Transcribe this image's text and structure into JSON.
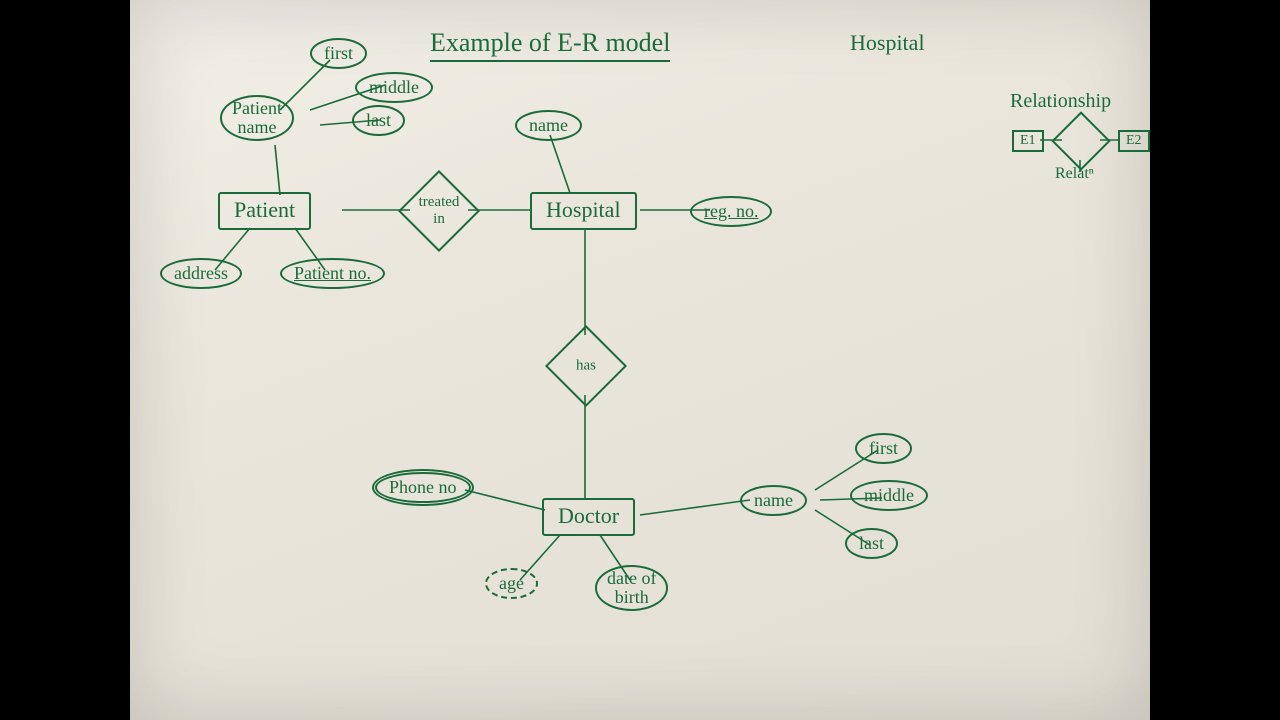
{
  "title": "Example of E-R model",
  "top_right_label": "Hospital",
  "entities": {
    "patient": "Patient",
    "hospital": "Hospital",
    "doctor": "Doctor"
  },
  "relationships": {
    "treated_in": "treated\nin",
    "has": "has"
  },
  "attributes": {
    "patient_name": "Patient\nname",
    "first": "first",
    "middle": "middle",
    "last": "last",
    "address": "address",
    "patient_no": "Patient no.",
    "hospital_name": "name",
    "reg_no": "reg. no.",
    "phone_no": "Phone no",
    "age": "age",
    "date_of_birth": "date of\nbirth",
    "doctor_name": "name",
    "d_first": "first",
    "d_middle": "middle",
    "d_last": "last"
  },
  "legend": {
    "title": "Relationship",
    "e1": "E1",
    "e2": "E2",
    "relat": "Relatⁿ"
  }
}
